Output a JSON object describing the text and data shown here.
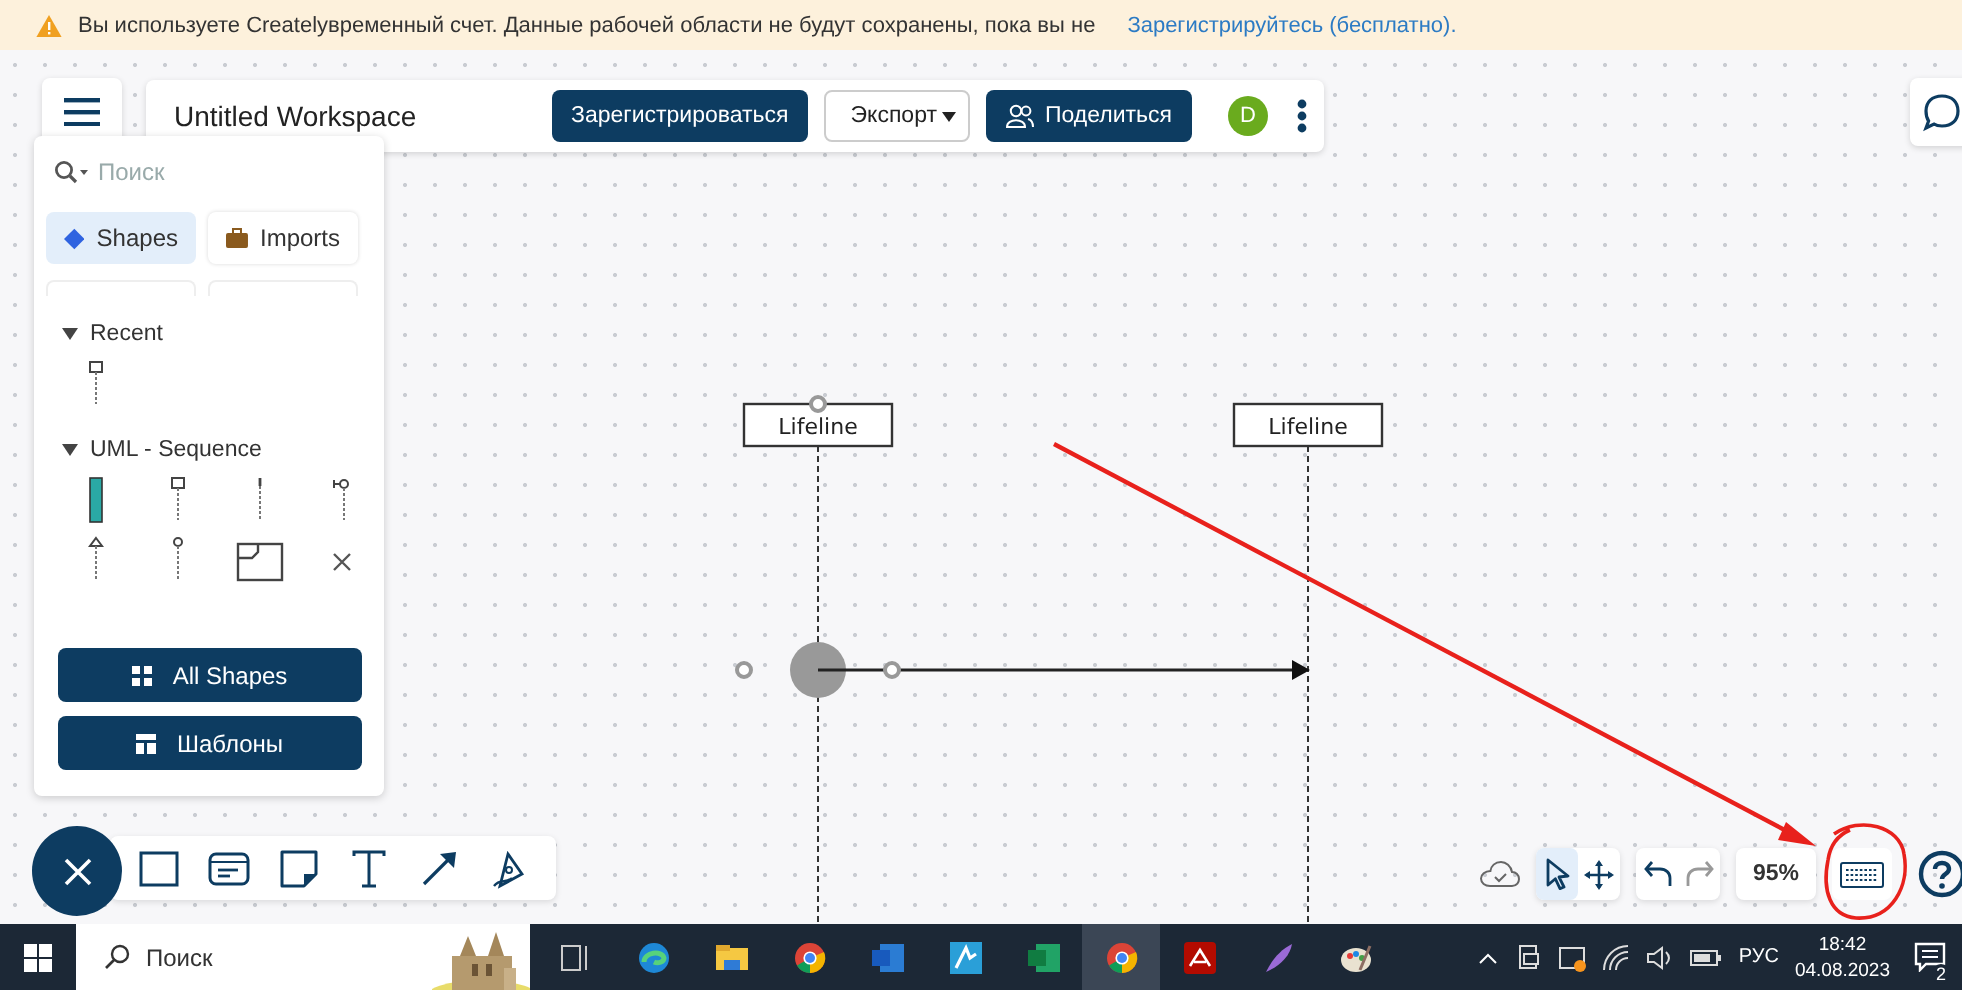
{
  "banner": {
    "text": "Вы используете Createlyвременный счет. Данные рабочей области не будут сохранены, пока вы не",
    "link": "Зарегистрируйтесь (бесплатно)."
  },
  "header": {
    "title": "Untitled Workspace",
    "register": "Зарегистрироваться",
    "export": "Экспорт",
    "share": "Поделиться",
    "avatar": "D"
  },
  "panel": {
    "search_placeholder": "Поиск",
    "tabs": [
      {
        "label": "Shapes",
        "kind": "shapes",
        "selected": true
      },
      {
        "label": "Imports",
        "kind": "imports",
        "selected": false
      }
    ],
    "sections": [
      {
        "title": "Recent",
        "expanded": true,
        "shapes": [
          {
            "kind": "object"
          }
        ]
      },
      {
        "title": "UML - Sequence",
        "expanded": true,
        "shapes": [
          {
            "kind": "activation"
          },
          {
            "kind": "object"
          },
          {
            "kind": "plain"
          },
          {
            "kind": "boundary"
          },
          {
            "kind": "actor"
          },
          {
            "kind": "entity"
          },
          {
            "kind": "frame"
          },
          {
            "kind": "destroy"
          }
        ]
      }
    ],
    "buttons": [
      {
        "label": "All Shapes",
        "kind": "grid"
      },
      {
        "label": "Шаблоны",
        "kind": "template"
      }
    ]
  },
  "diagram": {
    "lifelines": [
      {
        "label": "Lifeline"
      },
      {
        "label": "Lifeline"
      }
    ]
  },
  "tools": [
    {
      "kind": "rectangle"
    },
    {
      "kind": "card"
    },
    {
      "kind": "note"
    },
    {
      "kind": "text"
    },
    {
      "kind": "arrow"
    },
    {
      "kind": "pen"
    }
  ],
  "modes": [
    {
      "kind": "select",
      "selected": true
    },
    {
      "kind": "pan",
      "selected": false
    }
  ],
  "zoom": "95%",
  "taskbar": {
    "search_placeholder": "Поиск",
    "apps": [
      {
        "kind": "taskview",
        "active": false
      },
      {
        "kind": "edge",
        "active": false
      },
      {
        "kind": "folder",
        "active": false
      },
      {
        "kind": "chrome",
        "active": false
      },
      {
        "kind": "word",
        "active": false
      },
      {
        "kind": "blue",
        "active": false
      },
      {
        "kind": "excel",
        "active": false
      },
      {
        "kind": "chrome",
        "active": true
      },
      {
        "kind": "acrobat",
        "active": false
      },
      {
        "kind": "feather",
        "active": false
      },
      {
        "kind": "paint",
        "active": false
      }
    ],
    "language": "РУС",
    "time": "18:42",
    "date": "04.08.2023",
    "notifications": "2"
  }
}
